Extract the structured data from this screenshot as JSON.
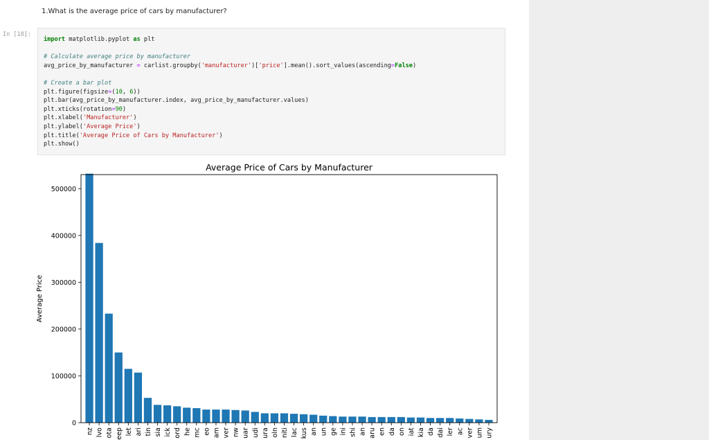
{
  "question": "1.What is the average price of cars by manufacturer?",
  "cell_prompt": "In [18]:",
  "code_lines": [
    [
      {
        "t": "import",
        "c": "kw"
      },
      {
        "t": " matplotlib.pyplot "
      },
      {
        "t": "as",
        "c": "kw"
      },
      {
        "t": " plt"
      }
    ],
    [],
    [
      {
        "t": "# Calculate average price by manufacturer",
        "c": "cm"
      }
    ],
    [
      {
        "t": "avg_price_by_manufacturer "
      },
      {
        "t": "=",
        "c": "op"
      },
      {
        "t": " carlist.groupby("
      },
      {
        "t": "'manufacturer'",
        "c": "st"
      },
      {
        "t": ")["
      },
      {
        "t": "'price'",
        "c": "st"
      },
      {
        "t": "].mean().sort_values(ascending"
      },
      {
        "t": "=",
        "c": "op"
      },
      {
        "t": "False",
        "c": "bi"
      },
      {
        "t": ")"
      }
    ],
    [],
    [
      {
        "t": "# Create a bar plot",
        "c": "cm"
      }
    ],
    [
      {
        "t": "plt.figure(figsize"
      },
      {
        "t": "=",
        "c": "op"
      },
      {
        "t": "("
      },
      {
        "t": "10",
        "c": "nu"
      },
      {
        "t": ", "
      },
      {
        "t": "6",
        "c": "nu"
      },
      {
        "t": "))"
      }
    ],
    [
      {
        "t": "plt.bar(avg_price_by_manufacturer.index, avg_price_by_manufacturer.values)"
      }
    ],
    [
      {
        "t": "plt.xticks(rotation"
      },
      {
        "t": "=",
        "c": "op"
      },
      {
        "t": "90",
        "c": "nu"
      },
      {
        "t": ")"
      }
    ],
    [
      {
        "t": "plt.xlabel("
      },
      {
        "t": "'Manufacturer'",
        "c": "st"
      },
      {
        "t": ")"
      }
    ],
    [
      {
        "t": "plt.ylabel("
      },
      {
        "t": "'Average Price'",
        "c": "st"
      },
      {
        "t": ")"
      }
    ],
    [
      {
        "t": "plt.title("
      },
      {
        "t": "'Average Price of Cars by Manufacturer'",
        "c": "st"
      },
      {
        "t": ")"
      }
    ],
    [
      {
        "t": "plt.show()"
      }
    ]
  ],
  "colors": {
    "bar": "#1f77b4",
    "keyword": "#008000",
    "comment": "#408080",
    "string": "#ba2121"
  },
  "chart_data": {
    "type": "bar",
    "title": "Average Price of Cars by Manufacturer",
    "ylabel": "Average Price",
    "xlabel": "",
    "ylim": [
      0,
      530000
    ],
    "yticks": [
      0,
      100000,
      200000,
      300000,
      400000,
      500000
    ],
    "ytick_labels": [
      "0",
      "100000",
      "200000",
      "300000",
      "400000",
      "500000"
    ],
    "categories": [
      "nz",
      "lvo",
      "ota",
      "eep",
      "let",
      "ari",
      "tin",
      "sia",
      "ick",
      "ord",
      "he",
      "mc",
      "eo",
      "am",
      "ver",
      "nw",
      "uar",
      "udi",
      "ura",
      "oln",
      "niti",
      "lac",
      "kus",
      "an",
      "un",
      "ge",
      "ini",
      "shi",
      "an",
      "aru",
      "en",
      "da",
      "on",
      "iat",
      "kia",
      "da",
      "dai",
      "ler",
      "ac",
      "ver",
      "um",
      "ury"
    ],
    "values": [
      532000,
      384000,
      233000,
      150000,
      115000,
      107000,
      53000,
      38000,
      37000,
      35000,
      32000,
      31000,
      28000,
      28000,
      28000,
      27000,
      26000,
      23000,
      20000,
      20000,
      20000,
      19000,
      18000,
      17000,
      15000,
      14000,
      13000,
      13000,
      13000,
      12000,
      12000,
      12000,
      12000,
      11000,
      11000,
      10000,
      10000,
      10000,
      9000,
      8000,
      7000,
      6000
    ]
  }
}
